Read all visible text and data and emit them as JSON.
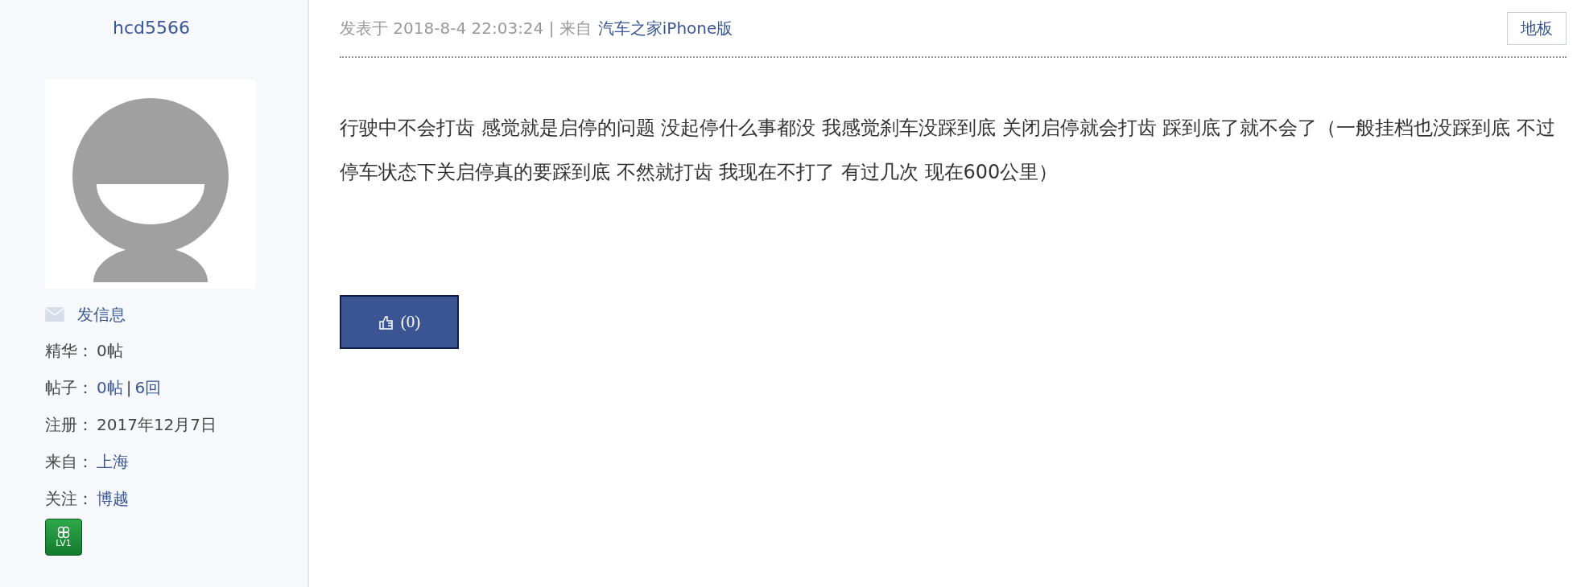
{
  "user": {
    "name": "hcd5566",
    "message_link": "发信息",
    "level_badge": "LV1",
    "stats": [
      {
        "label": "精华：",
        "parts": [
          {
            "text": "0帖",
            "link": false
          }
        ]
      },
      {
        "label": "帖子：",
        "parts": [
          {
            "text": "0帖",
            "link": true
          },
          {
            "text": "|",
            "link": false
          },
          {
            "text": "6回",
            "link": true
          }
        ]
      },
      {
        "label": "注册：",
        "parts": [
          {
            "text": "2017年12月7日",
            "link": false
          }
        ]
      },
      {
        "label": "来自：",
        "parts": [
          {
            "text": "上海",
            "link": true
          }
        ]
      },
      {
        "label": "关注：",
        "parts": [
          {
            "text": "博越",
            "link": true
          }
        ]
      }
    ]
  },
  "post": {
    "meta": "发表于 2018-8-4 22:03:24 | 来自",
    "source": "汽车之家iPhone版",
    "floor": "地板",
    "body": "行驶中不会打齿 感觉就是启停的问题 没起停什么事都没 我感觉刹车没踩到底 关闭启停就会打齿 踩到底了就不会了（一般挂档也没踩到底 不过停车状态下关启停真的要踩到底 不然就打齿 我现在不打了 有过几次 现在600公里）",
    "like_count": "(0)"
  }
}
